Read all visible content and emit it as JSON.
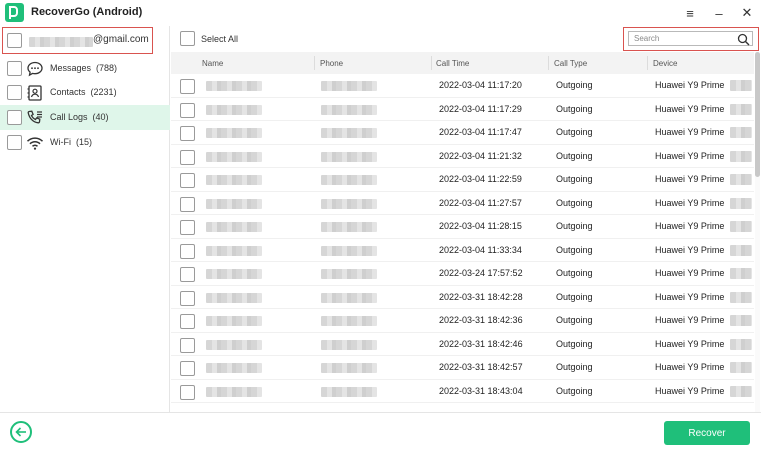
{
  "app": {
    "title": "RecoverGo (Android)"
  },
  "window": {
    "menu_icon": "≡",
    "minimize_icon": "–",
    "close_icon": "✕"
  },
  "account": {
    "domain": "@gmail.com"
  },
  "sidebar": {
    "items": [
      {
        "label": "Messages",
        "count": "(788)",
        "icon": "message-icon"
      },
      {
        "label": "Contacts",
        "count": "(2231)",
        "icon": "contacts-icon"
      },
      {
        "label": "Call Logs",
        "count": "(40)",
        "icon": "call-log-icon",
        "active": true
      },
      {
        "label": "Wi-Fi",
        "count": "(15)",
        "icon": "wifi-icon"
      }
    ]
  },
  "toolbar": {
    "select_all_label": "Select All"
  },
  "search": {
    "placeholder": "Search"
  },
  "table": {
    "columns": [
      "Name",
      "Phone",
      "Call Time",
      "Call Type",
      "Device"
    ],
    "rows": [
      {
        "call_time": "2022-03-04 11:17:20",
        "call_type": "Outgoing",
        "device": "Huawei Y9 Prime"
      },
      {
        "call_time": "2022-03-04 11:17:29",
        "call_type": "Outgoing",
        "device": "Huawei Y9 Prime"
      },
      {
        "call_time": "2022-03-04 11:17:47",
        "call_type": "Outgoing",
        "device": "Huawei Y9 Prime"
      },
      {
        "call_time": "2022-03-04 11:21:32",
        "call_type": "Outgoing",
        "device": "Huawei Y9 Prime"
      },
      {
        "call_time": "2022-03-04 11:22:59",
        "call_type": "Outgoing",
        "device": "Huawei Y9 Prime"
      },
      {
        "call_time": "2022-03-04 11:27:57",
        "call_type": "Outgoing",
        "device": "Huawei Y9 Prime"
      },
      {
        "call_time": "2022-03-04 11:28:15",
        "call_type": "Outgoing",
        "device": "Huawei Y9 Prime"
      },
      {
        "call_time": "2022-03-04 11:33:34",
        "call_type": "Outgoing",
        "device": "Huawei Y9 Prime"
      },
      {
        "call_time": "2022-03-24 17:57:52",
        "call_type": "Outgoing",
        "device": "Huawei Y9 Prime"
      },
      {
        "call_time": "2022-03-31 18:42:28",
        "call_type": "Outgoing",
        "device": "Huawei Y9 Prime"
      },
      {
        "call_time": "2022-03-31 18:42:36",
        "call_type": "Outgoing",
        "device": "Huawei Y9 Prime"
      },
      {
        "call_time": "2022-03-31 18:42:46",
        "call_type": "Outgoing",
        "device": "Huawei Y9 Prime"
      },
      {
        "call_time": "2022-03-31 18:42:57",
        "call_type": "Outgoing",
        "device": "Huawei Y9 Prime"
      },
      {
        "call_time": "2022-03-31 18:43:04",
        "call_type": "Outgoing",
        "device": "Huawei Y9 Prime"
      }
    ]
  },
  "footer": {
    "recover_label": "Recover"
  },
  "colors": {
    "accent": "#1fbf7a",
    "highlight_border": "#d9534f",
    "active_bg": "#dff6ea"
  }
}
